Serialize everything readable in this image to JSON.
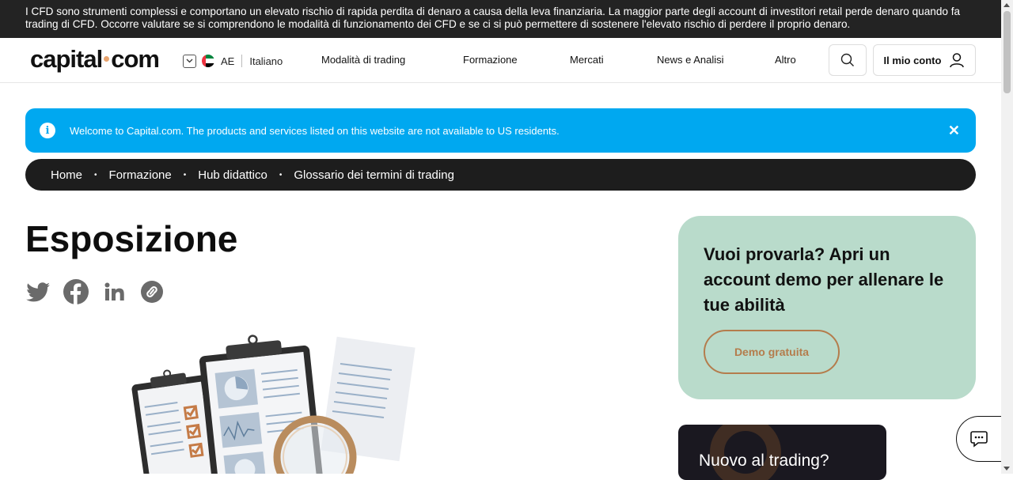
{
  "risk_warning": "I CFD sono strumenti complessi e comportano un elevato rischio di rapida perdita di denaro a causa della leva finanziaria. La maggior parte degli account di investitori retail perde denaro quando fa trading di CFD. Occorre valutare se si comprendono le modalità di funzionamento dei CFD e se ci si può permettere di sostenere l'elevato rischio di perdere il proprio denaro.",
  "header": {
    "logo_left": "capital",
    "logo_right": "com",
    "region_code": "AE",
    "language": "Italiano",
    "nav": [
      "Modalità di trading",
      "Formazione",
      "Mercati",
      "News e Analisi",
      "Altro"
    ],
    "account_label": "Il mio conto",
    "icons": {
      "search": "search-icon",
      "user": "user-icon",
      "chevron": "chevron-down-icon"
    }
  },
  "us_banner": {
    "text": "Welcome to Capital.com. The products and services listed on this website are not available to US residents.",
    "info_glyph": "i",
    "close_glyph": "✕"
  },
  "breadcrumb": [
    "Home",
    "Formazione",
    "Hub didattico",
    "Glossario dei termini di trading"
  ],
  "page_title": "Esposizione",
  "share_icons": [
    "twitter-icon",
    "facebook-icon",
    "linkedin-icon",
    "copy-link-icon"
  ],
  "demo_card": {
    "title": "Vuoi provarla? Apri un account demo per allenare le tue abilità",
    "button": "Demo gratuita",
    "background": "#b9dbcb",
    "accent": "#b47c4c"
  },
  "new_card": {
    "title": "Nuovo al trading?"
  },
  "colors": {
    "banner": "#00a8f0",
    "dark": "#1d1d1d",
    "logo_dot": "#e8a36d"
  }
}
